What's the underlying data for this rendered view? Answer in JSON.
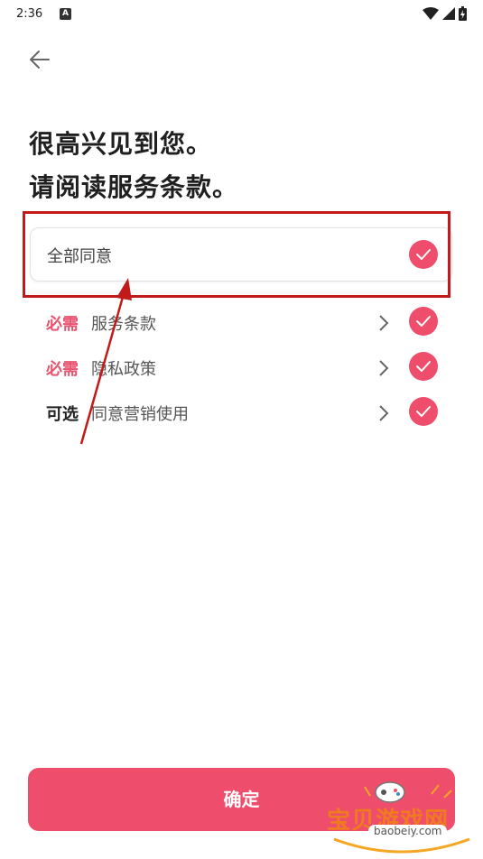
{
  "status_bar": {
    "time": "2:36",
    "app_icon_letter": "A"
  },
  "header": {
    "title_line1": "很高兴见到您。",
    "title_line2": "请阅读服务条款。"
  },
  "agree_all": {
    "label": "全部同意",
    "checked": true
  },
  "terms": [
    {
      "tag": "必需",
      "tag_kind": "required",
      "label": "服务条款",
      "checked": true
    },
    {
      "tag": "必需",
      "tag_kind": "required",
      "label": "隐私政策",
      "checked": true
    },
    {
      "tag": "可选",
      "tag_kind": "optional",
      "label": "同意营销使用",
      "checked": true
    }
  ],
  "confirm": {
    "label": "确定"
  },
  "watermark": {
    "text": "宝贝游戏网",
    "url": "baobeiy.com"
  },
  "colors": {
    "accent": "#ef4d6c",
    "required_tag": "#e8536f",
    "highlight": "#c21919"
  }
}
